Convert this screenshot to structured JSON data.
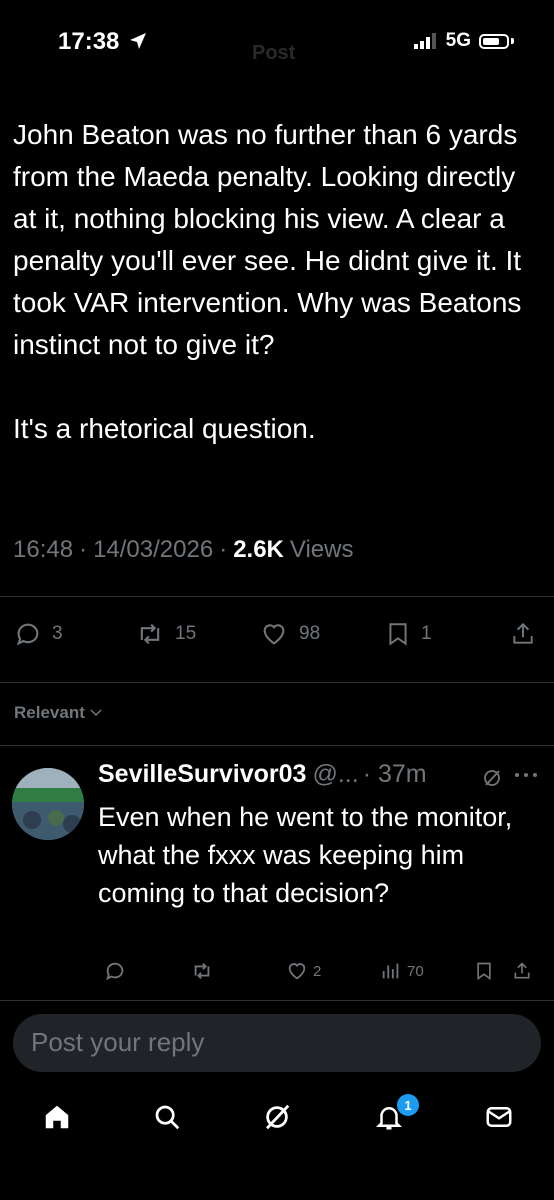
{
  "status_bar": {
    "time": "17:38",
    "network": "5G",
    "header_ghost": "Post"
  },
  "tweet": {
    "text": "John Beaton was no further than 6 yards from the Maeda penalty. Looking directly at it, nothing blocking his view. A clear a penalty you'll ever see. He didnt give it. It took  VAR intervention. Why was Beatons instinct not to give it?\n\nIt's a rhetorical question.",
    "time": "16:48",
    "date": "14/03/2026",
    "views_count": "2.6K",
    "views_label": "Views",
    "sep": "·",
    "actions": {
      "replies": "3",
      "reposts": "15",
      "likes": "98",
      "bookmarks": "1"
    }
  },
  "sort": {
    "label": "Relevant"
  },
  "reply": {
    "name": "SevilleSurvivor03",
    "handle": "@...",
    "time": "· 37m",
    "text": "Even when he went to the monitor,  what the fxxx was keeping him coming to that decision?",
    "actions": {
      "likes": "2",
      "views": "70"
    }
  },
  "composer": {
    "placeholder": "Post your reply"
  },
  "nav": {
    "notifications_badge": "1",
    "icons": [
      "home-icon",
      "search-icon",
      "grok-icon",
      "notifications-icon",
      "messages-icon"
    ]
  },
  "colors": {
    "background": "#000000",
    "text": "#e7e9ea",
    "muted": "#71767b",
    "accent": "#1d9bf0",
    "divider": "#2f3336"
  }
}
